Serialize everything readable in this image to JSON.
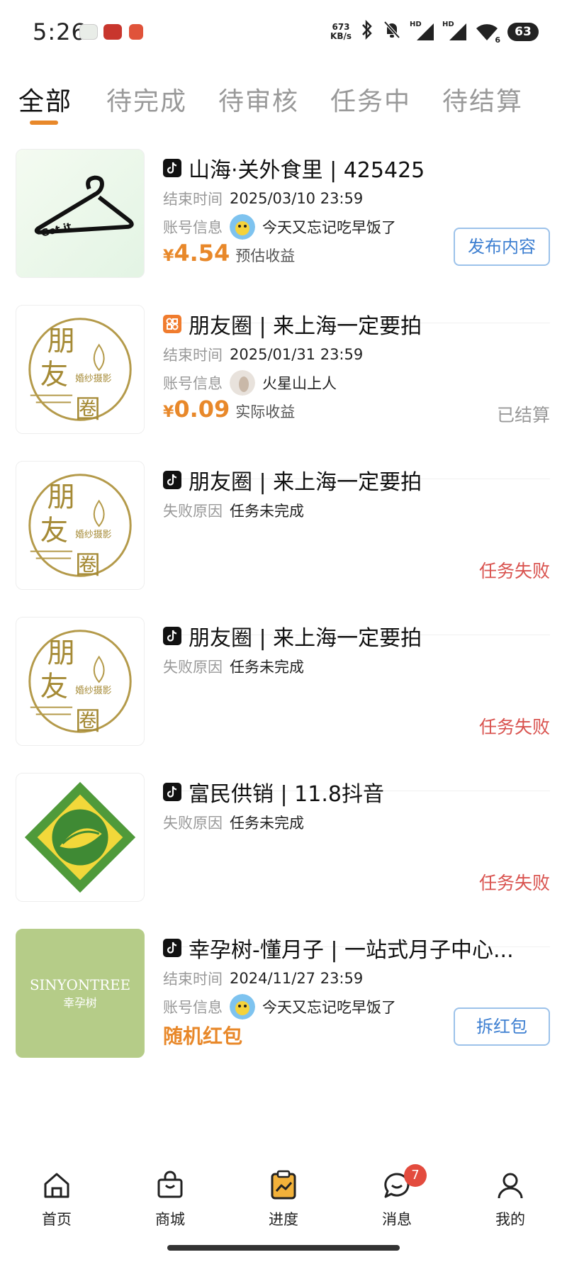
{
  "status_bar": {
    "time": "5:26",
    "net_speed_value": "673",
    "net_speed_unit": "KB/s",
    "hd_label": "HD",
    "wifi_label": "6",
    "battery": "63"
  },
  "tabs": [
    {
      "label": "全部",
      "active": true
    },
    {
      "label": "待完成",
      "active": false
    },
    {
      "label": "待审核",
      "active": false
    },
    {
      "label": "任务中",
      "active": false
    },
    {
      "label": "待结算",
      "active": false
    }
  ],
  "tasks": [
    {
      "platform": "douyin",
      "title": "山海·关外食里 | 425425",
      "thumb_text": "Got it",
      "meta": [
        {
          "label": "结束时间",
          "value": "2025/03/10 23:59"
        },
        {
          "label": "账号信息",
          "value": "今天又忘记吃早饭了"
        }
      ],
      "earning": {
        "currency": "¥",
        "amount": "4.54",
        "label": "预估收益"
      },
      "action_label": "发布内容"
    },
    {
      "platform": "pyq",
      "title": "朋友圈 | 来上海一定要拍",
      "thumb_text": "婚纱摄影",
      "meta": [
        {
          "label": "结束时间",
          "value": "2025/01/31 23:59"
        },
        {
          "label": "账号信息",
          "value": "火星山上人"
        }
      ],
      "earning": {
        "currency": "¥",
        "amount": "0.09",
        "label": "实际收益"
      },
      "status": "已结算"
    },
    {
      "platform": "douyin",
      "title": "朋友圈 | 来上海一定要拍",
      "thumb_text": "婚纱摄影",
      "meta": [
        {
          "label": "失败原因",
          "value": "任务未完成"
        }
      ],
      "status": "任务失败"
    },
    {
      "platform": "douyin",
      "title": "朋友圈 | 来上海一定要拍",
      "thumb_text": "婚纱摄影",
      "meta": [
        {
          "label": "失败原因",
          "value": "任务未完成"
        }
      ],
      "status": "任务失败"
    },
    {
      "platform": "douyin",
      "title": "富民供销 | 11.8抖音",
      "meta": [
        {
          "label": "失败原因",
          "value": "任务未完成"
        }
      ],
      "status": "任务失败"
    },
    {
      "platform": "douyin",
      "title": "幸孕树-懂月子 | 一站式月子中心...",
      "thumb_text_en": "SINYONTREE",
      "thumb_text_cn": "幸孕树",
      "meta": [
        {
          "label": "结束时间",
          "value": "2024/11/27 23:59"
        },
        {
          "label": "账号信息",
          "value": "今天又忘记吃早饭了"
        }
      ],
      "random_label": "随机红包",
      "action_label": "拆红包"
    }
  ],
  "bottom_nav": [
    {
      "label": "首页",
      "icon": "home-icon"
    },
    {
      "label": "商城",
      "icon": "shopping-bag-icon"
    },
    {
      "label": "进度",
      "icon": "progress-icon"
    },
    {
      "label": "消息",
      "icon": "message-icon",
      "badge": "7"
    },
    {
      "label": "我的",
      "icon": "profile-icon"
    }
  ],
  "colors": {
    "accent": "#e8882a",
    "failed": "#d9534f",
    "link": "#3d7fd1",
    "badge": "#e34b3e"
  }
}
